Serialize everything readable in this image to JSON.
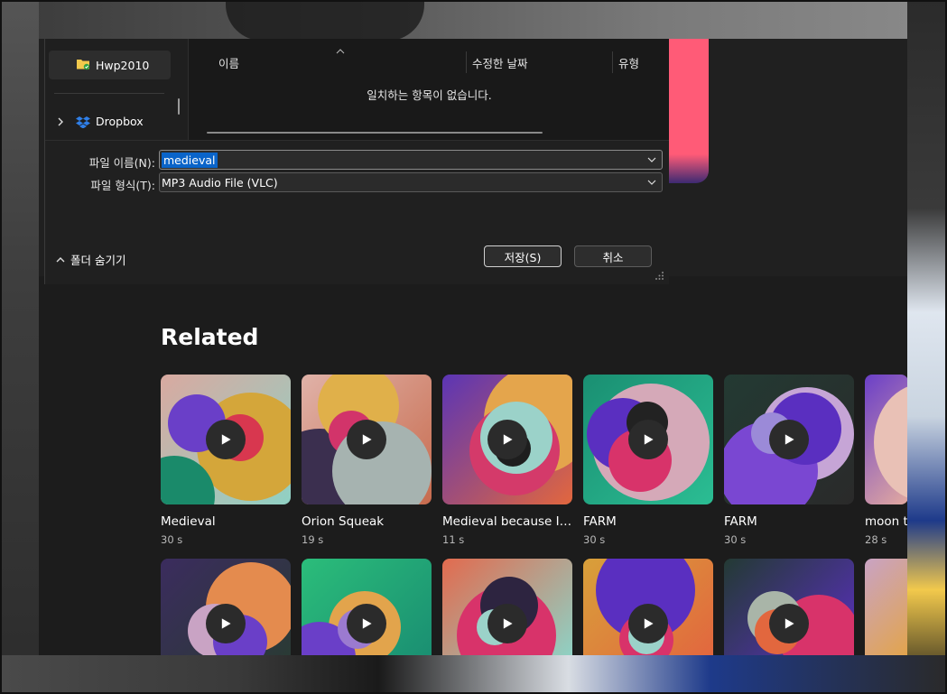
{
  "dialog": {
    "nav": {
      "selected_item": "Hwp2010",
      "dropbox_item": "Dropbox"
    },
    "columns": {
      "name": "이름",
      "modified": "수정한 날짜",
      "type": "유형"
    },
    "empty_message": "일치하는 항목이 없습니다.",
    "filename_label": "파일 이름(N):",
    "filename_value": "medieval",
    "filetype_label": "파일 형식(T):",
    "filetype_value": "MP3 Audio File (VLC)",
    "hide_folders": "폴더 숨기기",
    "save_button": "저장(S)",
    "cancel_button": "취소"
  },
  "related": {
    "title": "Related",
    "row1": [
      {
        "title": "Medieval",
        "duration": "30 s"
      },
      {
        "title": "Orion Squeak",
        "duration": "19 s"
      },
      {
        "title": "Medieval because I ...",
        "duration": "11 s"
      },
      {
        "title": "FARM",
        "duration": "30 s"
      },
      {
        "title": "FARM",
        "duration": "30 s"
      },
      {
        "title": "moon tv",
        "duration": "28 s"
      }
    ]
  },
  "colors": {
    "accent_selection": "#0a64c9",
    "hero_pink": "#ff5b77"
  }
}
